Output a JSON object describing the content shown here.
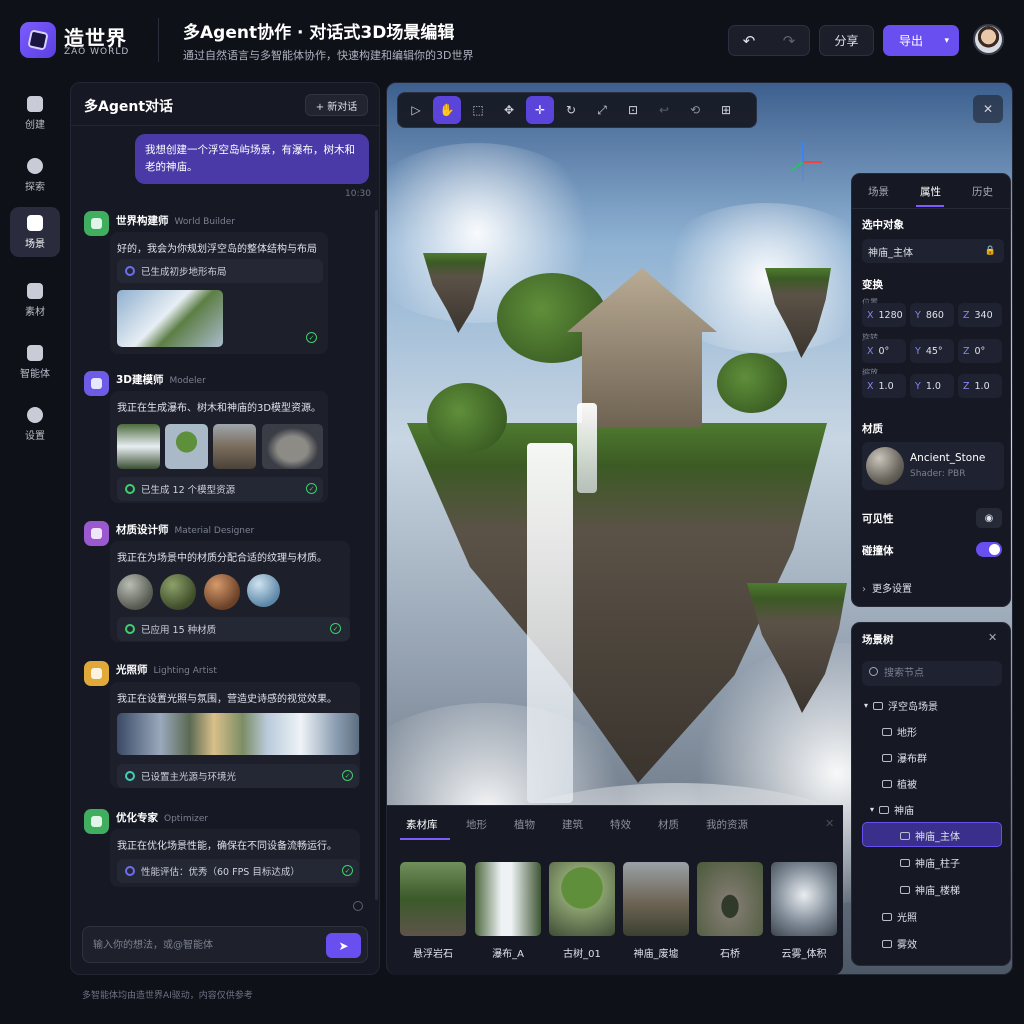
{
  "brand": {
    "name": "造世界",
    "subtitle": "ZAO WORLD"
  },
  "header": {
    "title": "多Agent协作 · 对话式3D场景编辑",
    "subtitle": "通过自然语言与多智能体协作，快速构建和编辑你的3D世界",
    "share_label": "分享",
    "export_label": "导出"
  },
  "icons": {
    "undo": "undo-icon",
    "redo": "redo-icon",
    "dropdown": "chevron-down-icon"
  },
  "nav": {
    "items": [
      {
        "label": "创建",
        "icon": "plus-square-icon"
      },
      {
        "label": "探索",
        "icon": "compass-icon"
      },
      {
        "label": "场景",
        "icon": "scene-cube-icon"
      },
      {
        "label": "素材",
        "icon": "folder-icon"
      },
      {
        "label": "智能体",
        "icon": "agent-cube-icon"
      },
      {
        "label": "设置",
        "icon": "gear-icon"
      }
    ],
    "active": "场景"
  },
  "chat": {
    "title": "多Agent对话",
    "new_chat_label": "+ 新对话",
    "user_message_line1": "我想创建一个浮空岛屿场景，有瀑布，树木和",
    "user_message_line2": "老的神庙。",
    "user_time": "10:30",
    "agents": [
      {
        "name": "世界构建师",
        "role": "World Builder",
        "color": "#3fae5f",
        "message": "好的，我会为你规划浮空岛的整体结构与布局",
        "status": "已生成初步地形布局"
      },
      {
        "name": "3D建模师",
        "role": "Modeler",
        "color": "#6c5ce7",
        "message": "我正在生成瀑布、树木和神庙的3D模型资源。",
        "status": "已生成 12 个模型资源"
      },
      {
        "name": "材质设计师",
        "role": "Material Designer",
        "color": "#9b59d0",
        "message": "我正在为场景中的材质分配合适的纹理与材质。",
        "status": "已应用 15 种材质"
      },
      {
        "name": "光照师",
        "role": "Lighting Artist",
        "color": "#e0a93a",
        "message": "我正在设置光照与氛围，营造史诗感的视觉效果。",
        "status": "已设置主光源与环境光"
      },
      {
        "name": "优化专家",
        "role": "Optimizer",
        "color": "#3fae5f",
        "message": "我正在优化场景性能，确保在不同设备流畅运行。",
        "status": "性能评估：优秀（60 FPS 目标达成）"
      }
    ],
    "input_placeholder": "输入你的想法，或@智能体",
    "footnote": "多智能体均由造世界AI驱动，内容仅供参考"
  },
  "properties": {
    "tabs": [
      "场景",
      "属性",
      "历史"
    ],
    "active_tab": "属性",
    "selected_label": "选中对象",
    "selected_value": "神庙_主体",
    "transform_label": "变换",
    "position_label": "位置",
    "rotation_label": "旋转",
    "scale_label": "缩放",
    "position": {
      "x": "1280",
      "y": "860",
      "z": "340"
    },
    "rotation": {
      "x": "0°",
      "y": "45°",
      "z": "0°"
    },
    "scale": {
      "x": "1.0",
      "y": "1.0",
      "z": "1.0"
    },
    "material_label": "材质",
    "material_name": "Ancient_Stone",
    "material_shader": "Shader: PBR",
    "visibility_label": "可见性",
    "collider_label": "碰撞体",
    "more_label": "更多设置"
  },
  "scene_tree": {
    "title": "场景树",
    "search_placeholder": "搜索节点",
    "root": "浮空岛场景",
    "nodes": [
      "地形",
      "瀑布群",
      "植被",
      "神庙"
    ],
    "temple_children": [
      "神庙_主体",
      "神庙_柱子",
      "神庙_楼梯"
    ],
    "tail": [
      "光照",
      "雾效"
    ],
    "selected": "神庙_主体"
  },
  "assets": {
    "tabs": [
      "素材库",
      "地形",
      "植物",
      "建筑",
      "特效",
      "材质",
      "我的资源"
    ],
    "active_tab": "素材库",
    "items": [
      "悬浮岩石",
      "瀑布_A",
      "古树_01",
      "神庙_废墟",
      "石桥",
      "云雾_体积"
    ]
  },
  "colors": {
    "accent": "#6a4ff0",
    "success": "#3fcf6b",
    "bg": "#0f1118"
  }
}
